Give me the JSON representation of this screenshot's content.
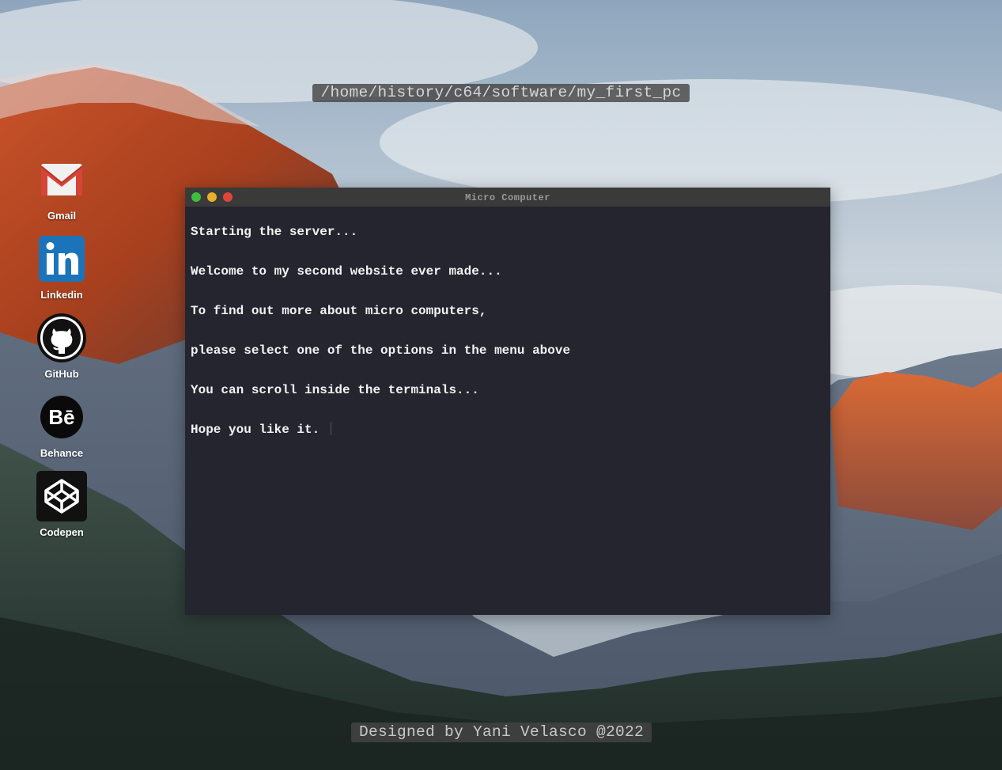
{
  "path_bar": {
    "path": "/home/history/c64/software/my_first_pc"
  },
  "desktop_icons": [
    {
      "label": "Gmail",
      "icon": "gmail-icon"
    },
    {
      "label": "Linkedin",
      "icon": "linkedin-icon"
    },
    {
      "label": "GitHub",
      "icon": "github-icon"
    },
    {
      "label": "Behance",
      "icon": "behance-icon"
    },
    {
      "label": "Codepen",
      "icon": "codepen-icon"
    }
  ],
  "window": {
    "title": "Micro Computer",
    "lines": [
      "Starting the server...",
      "Welcome to my second website ever made...",
      "To find out more about micro computers,",
      "please select one of the options in the menu above",
      "You can scroll inside the terminals...",
      "Hope you like it."
    ]
  },
  "footer": {
    "text": "Designed by Yani Velasco @2022"
  },
  "colors": {
    "terminal_bg": "#252530",
    "titlebar_bg": "#3a3a3a",
    "close": "#e0453a",
    "minimize": "#e6b126",
    "maximize": "#3fbf3f"
  }
}
